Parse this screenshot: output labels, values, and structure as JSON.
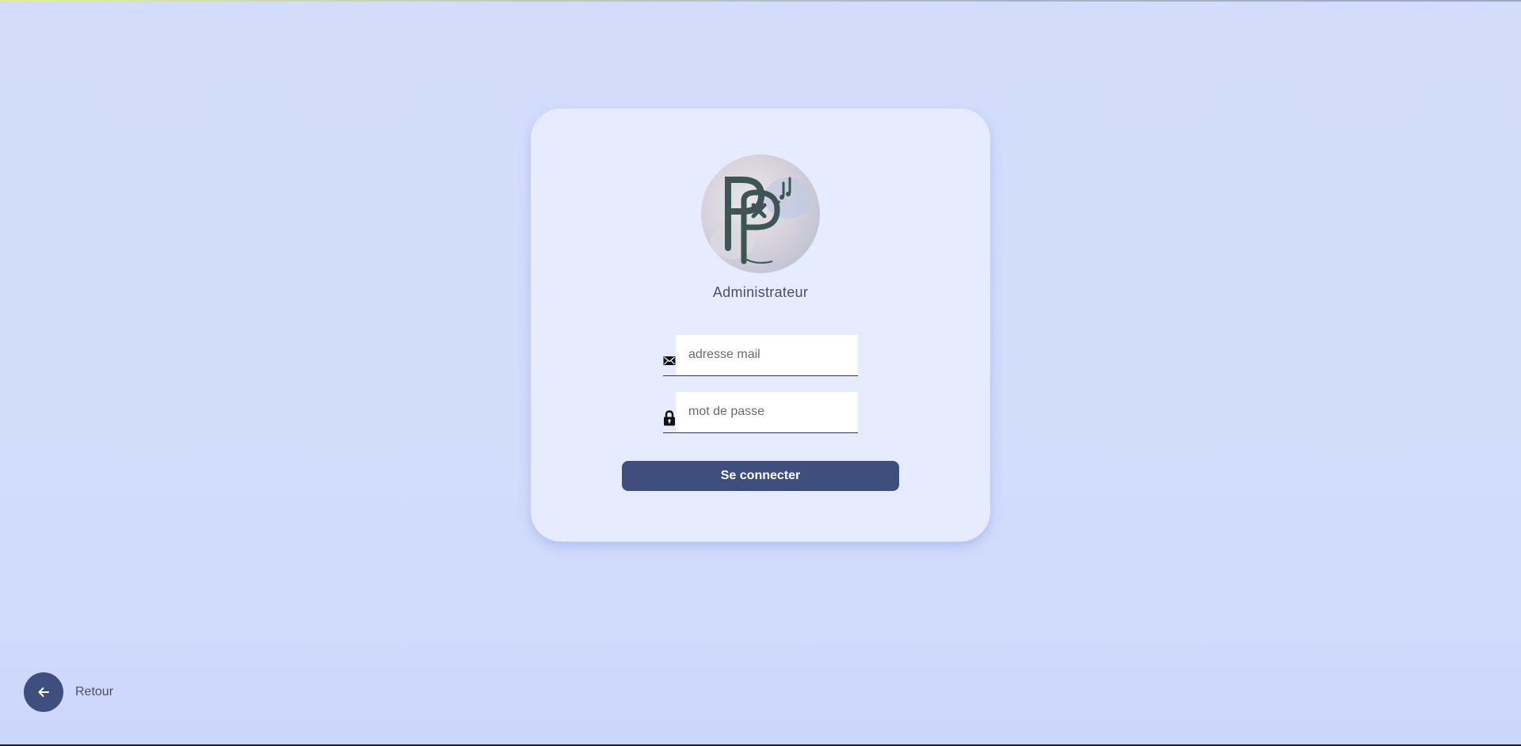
{
  "role_title": "Administrateur",
  "logo_text": "Pp",
  "form": {
    "email_placeholder": "adresse mail",
    "email_value": "",
    "password_placeholder": "mot de passe",
    "password_value": "",
    "submit_label": "Se connecter"
  },
  "back": {
    "label": "Retour"
  },
  "icons": {
    "email": "envelope-icon",
    "password": "lock-icon",
    "back": "arrow-left-icon"
  },
  "colors": {
    "background": "#d2dcfb",
    "card": "#e6ecfd",
    "accent": "#3e4f7e",
    "logo": "#3d5555"
  }
}
